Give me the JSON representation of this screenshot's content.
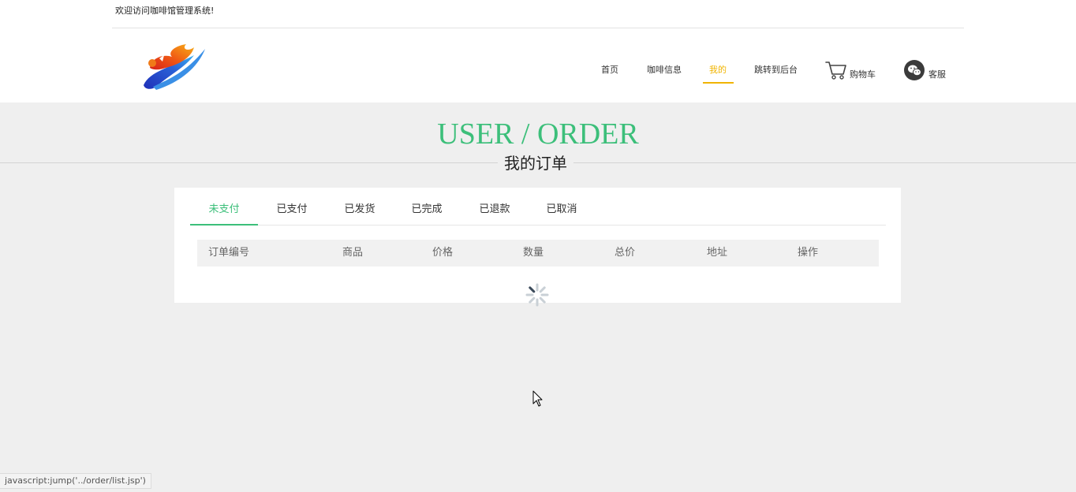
{
  "header": {
    "welcome_text": "欢迎访问咖啡馆管理系统!",
    "nav": [
      {
        "label": "首页",
        "active": false
      },
      {
        "label": "咖啡信息",
        "active": false
      },
      {
        "label": "我的",
        "active": true
      },
      {
        "label": "跳转到后台",
        "active": false
      }
    ],
    "cart_label": "购物车",
    "service_label": "客服",
    "accent_color": "#f0b400"
  },
  "section": {
    "title_en": "USER / ORDER",
    "title_cn": "我的订单",
    "title_color": "#3cbf7a"
  },
  "order_tabs": [
    {
      "label": "未支付",
      "active": true
    },
    {
      "label": "已支付",
      "active": false
    },
    {
      "label": "已发货",
      "active": false
    },
    {
      "label": "已完成",
      "active": false
    },
    {
      "label": "已退款",
      "active": false
    },
    {
      "label": "已取消",
      "active": false
    }
  ],
  "table": {
    "columns": [
      "订单编号",
      "商品",
      "价格",
      "数量",
      "总价",
      "地址",
      "操作"
    ],
    "rows": [],
    "loading": true
  },
  "status_bar": {
    "text": "javascript:jump('../order/list.jsp')"
  },
  "icons": {
    "logo": "brand-logo",
    "cart": "cart-icon",
    "service": "wechat-icon",
    "loading": "loading-spinner-icon",
    "cursor": "mouse-cursor-icon"
  }
}
